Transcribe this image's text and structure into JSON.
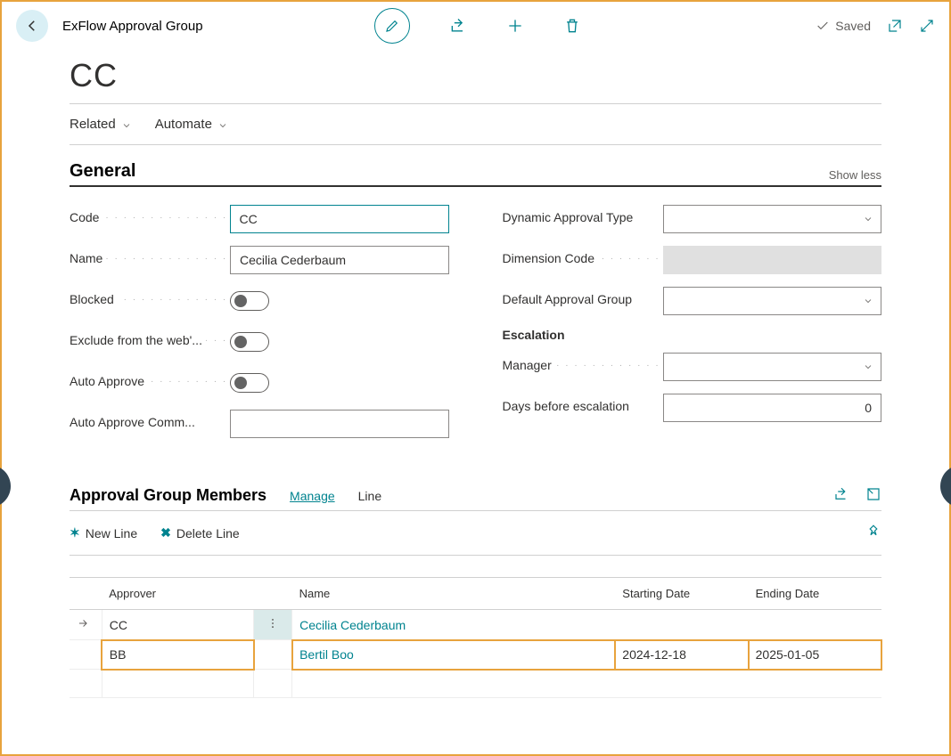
{
  "header": {
    "breadcrumb": "ExFlow Approval Group",
    "saved_label": "Saved"
  },
  "page_title": "CC",
  "menubar": [
    {
      "label": "Related"
    },
    {
      "label": "Automate"
    }
  ],
  "general": {
    "title": "General",
    "show_less": "Show less",
    "left": {
      "code_label": "Code",
      "code_value": "CC",
      "name_label": "Name",
      "name_value": "Cecilia Cederbaum",
      "blocked_label": "Blocked",
      "exclude_label": "Exclude from the web'...",
      "auto_approve_label": "Auto Approve",
      "auto_approve_comm_label": "Auto Approve Comm...",
      "auto_approve_comm_value": ""
    },
    "right": {
      "dyn_approval_label": "Dynamic Approval Type",
      "dim_code_label": "Dimension Code",
      "def_approval_label": "Default Approval Group",
      "escalation_title": "Escalation",
      "manager_label": "Manager",
      "days_label": "Days before escalation",
      "days_value": "0"
    }
  },
  "members": {
    "title": "Approval Group Members",
    "manage": "Manage",
    "line": "Line",
    "new_line": "New Line",
    "delete_line": "Delete Line",
    "columns": {
      "approver": "Approver",
      "name": "Name",
      "starting": "Starting Date",
      "ending": "Ending Date"
    },
    "rows": [
      {
        "approver": "CC",
        "name": "Cecilia Cederbaum",
        "starting": "",
        "ending": "",
        "selected": true
      },
      {
        "approver": "BB",
        "name": "Bertil Boo",
        "starting": "2024-12-18",
        "ending": "2025-01-05",
        "selected": false,
        "highlight": true
      },
      {
        "approver": "",
        "name": "",
        "starting": "",
        "ending": "",
        "selected": false
      }
    ]
  }
}
